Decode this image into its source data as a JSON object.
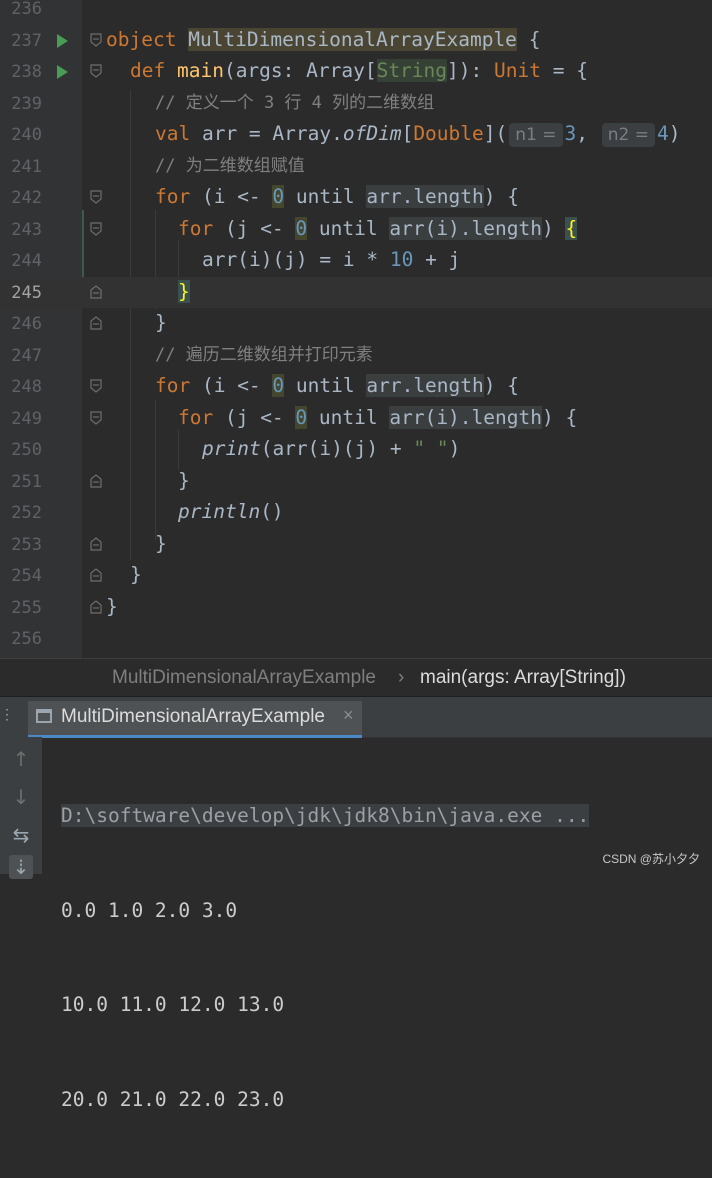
{
  "editor": {
    "lines": [
      {
        "num": "236"
      },
      {
        "num": "237",
        "obj_kw": "object",
        "obj_name": "MultiDimensionalArrayExample",
        "brace": "{"
      },
      {
        "num": "238",
        "def_kw": "def",
        "fn": "main",
        "p1": "(args: Array[",
        "p_type": "String",
        "p2": "]): ",
        "unit": "Unit",
        "p3": " = {"
      },
      {
        "num": "239",
        "comment": "// 定义一个 3 行 4 列的二维数组"
      },
      {
        "num": "240",
        "val_kw": "val",
        "t1": " arr = Array.",
        "ofdim": "ofDim",
        "t2": "[",
        "dbl": "Double",
        "t3": "](",
        "hint1": "n1 =",
        "n3": "3",
        "t4": ", ",
        "hint2": "n2 =",
        "n4": "4",
        "t5": ")"
      },
      {
        "num": "241",
        "comment": "// 为二维数组赋值"
      },
      {
        "num": "242",
        "for_kw": "for",
        "t1": " (i <- ",
        "zero": "0",
        "t2": " until ",
        "len": "arr.length",
        "t3": ") {"
      },
      {
        "num": "243",
        "for_kw": "for",
        "t1": " (j <- ",
        "zero": "0",
        "t2": " until ",
        "len": "arr(i).length",
        "t3": ") ",
        "brace": "{"
      },
      {
        "num": "244",
        "t1": "arr(i)(j) = i * ",
        "ten": "10",
        "t2": " + j"
      },
      {
        "num": "245",
        "brace": "}"
      },
      {
        "num": "246",
        "t1": "}"
      },
      {
        "num": "247",
        "comment": "// 遍历二维数组并打印元素"
      },
      {
        "num": "248",
        "for_kw": "for",
        "t1": " (i <- ",
        "zero": "0",
        "t2": " until ",
        "len": "arr.length",
        "t3": ") {"
      },
      {
        "num": "249",
        "for_kw": "for",
        "t1": " (j <- ",
        "zero": "0",
        "t2": " until ",
        "len": "arr(i).length",
        "t3": ") {"
      },
      {
        "num": "250",
        "print": "print",
        "t1": "(arr(i)(j) + ",
        "str": "\" \"",
        "t2": ")"
      },
      {
        "num": "251",
        "t1": "}"
      },
      {
        "num": "252",
        "println": "println",
        "t1": "()"
      },
      {
        "num": "253",
        "t1": "}"
      },
      {
        "num": "254",
        "t1": "}"
      },
      {
        "num": "255",
        "t1": "}"
      },
      {
        "num": "256"
      }
    ]
  },
  "breadcrumb": {
    "object": "MultiDimensionalArrayExample",
    "separator": "›",
    "method": "main(args: Array[String])"
  },
  "run_panel": {
    "tab_label": "MultiDimensionalArrayExample",
    "close": "×",
    "command": "D:\\software\\develop\\jdk\\jdk8\\bin\\java.exe ...",
    "output": [
      "0.0 1.0 2.0 3.0",
      "10.0 11.0 12.0 13.0",
      "20.0 21.0 22.0 23.0"
    ]
  },
  "watermark": "CSDN @苏小夕夕",
  "colors": {
    "background": "#2b2b2b",
    "keyword": "#cc7832",
    "function": "#ffc66d",
    "number": "#6897bb",
    "comment": "#808080",
    "string": "#6a8759",
    "run_arrow": "#499c54",
    "matched_brace": "#ffef28"
  },
  "icons": {
    "run_gutter": "run-arrow-icon",
    "fold": "fold-marker-icon",
    "up": "arrow-up-icon",
    "down": "arrow-down-icon",
    "wrap": "soft-wrap-icon",
    "scroll_end": "scroll-to-end-icon"
  }
}
